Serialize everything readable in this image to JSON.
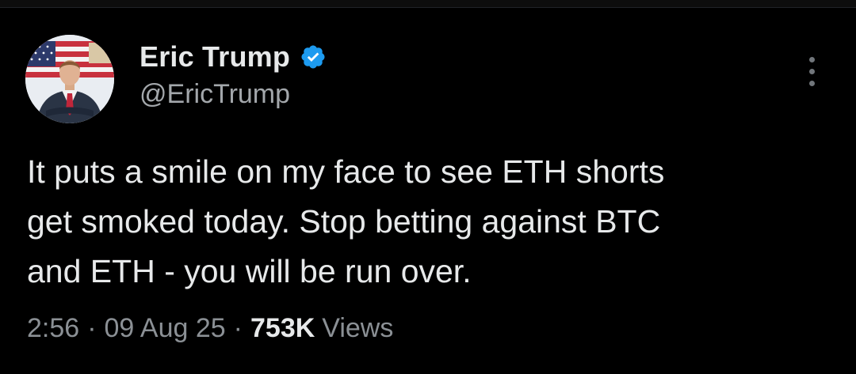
{
  "tweet": {
    "author": {
      "display_name": "Eric Trump",
      "handle": "@EricTrump",
      "verified": true,
      "verified_icon": "verified-badge-icon",
      "avatar_icon": "avatar-photo"
    },
    "text_lines": [
      "It puts a smile on my face to see ETH shorts",
      "get smoked today. Stop betting against BTC",
      "and ETH - you will be run over."
    ],
    "time": "2:56",
    "date": "09 Aug 25",
    "separator": "·",
    "views_count": "753K",
    "views_label": "Views",
    "more_icon": "more-vertical-icon"
  },
  "colors": {
    "background": "#000000",
    "text_primary": "#e7e9ea",
    "text_secondary": "#8b9095",
    "verified_blue": "#1d9bf0"
  }
}
